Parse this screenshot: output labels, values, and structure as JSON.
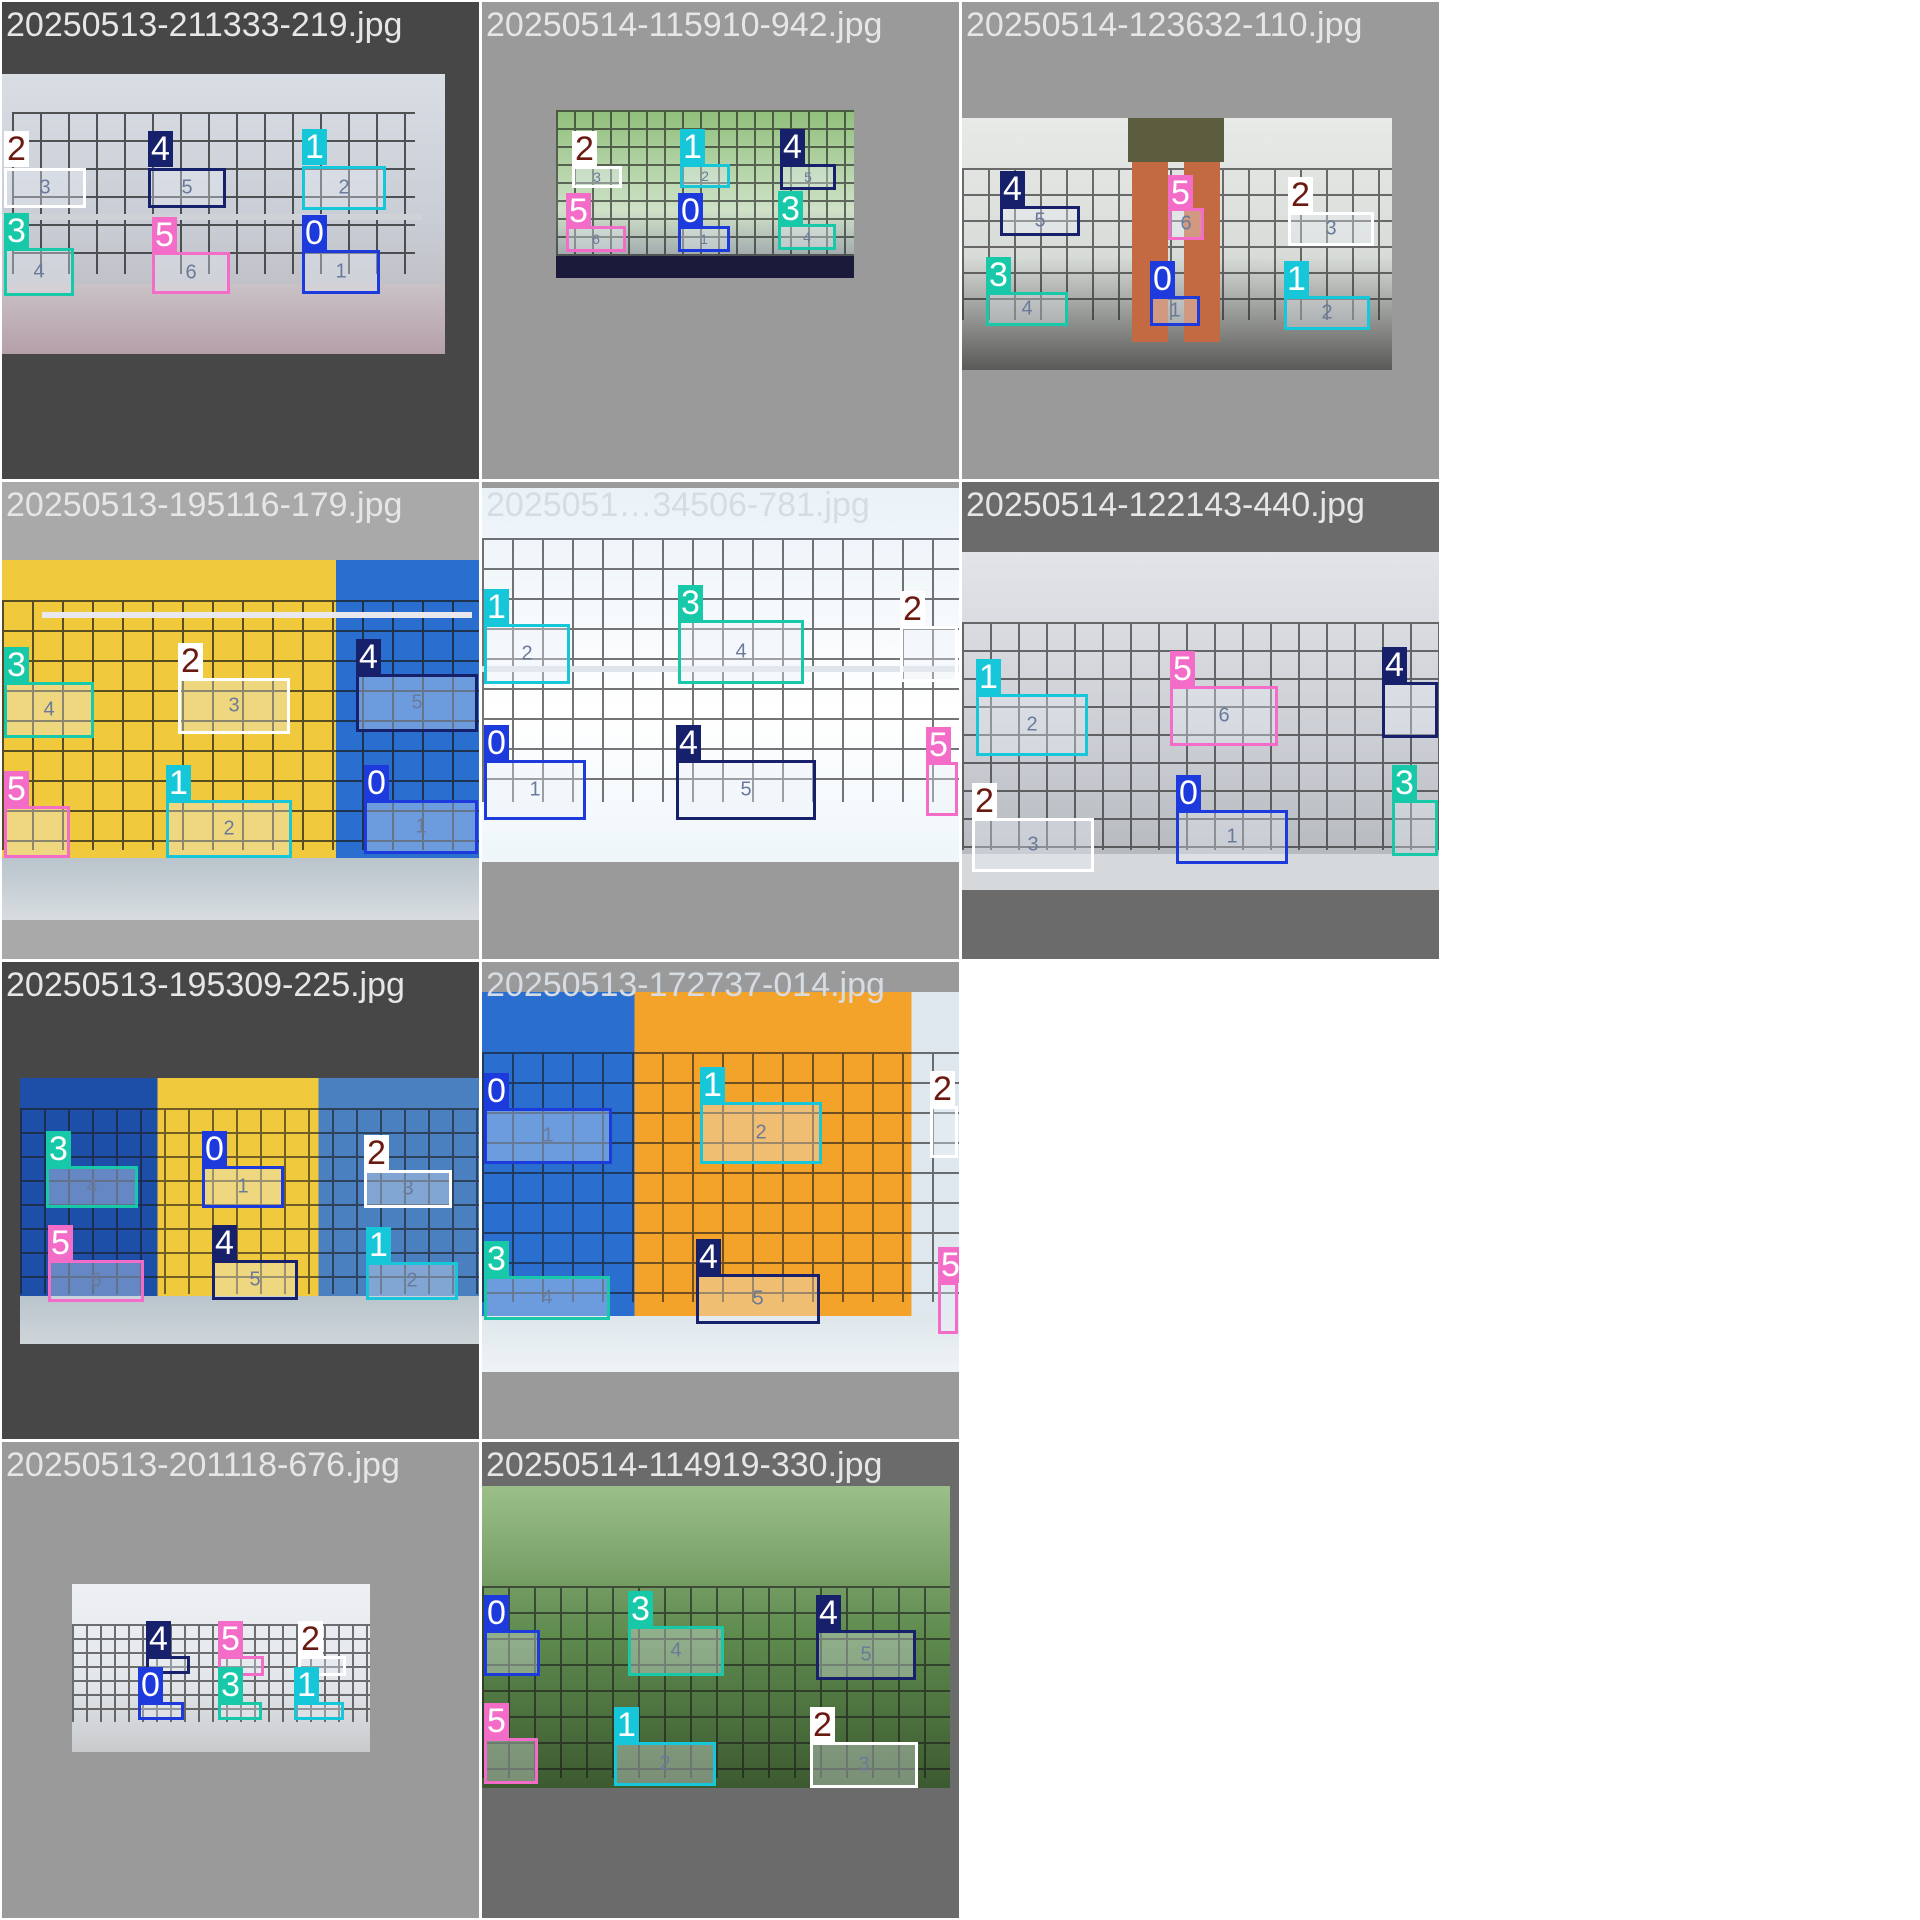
{
  "class_colors": {
    "0": "#1d3bdc",
    "1": "#16c7d9",
    "2": "#ffffff",
    "3": "#17c9a8",
    "4": "#17206b",
    "5": "#f36dc8"
  },
  "label_text_colors": {
    "0": "#ffffff",
    "1": "#ffffff",
    "2": "#6b1a12",
    "3": "#ffffff",
    "4": "#ffffff",
    "5": "#ffffff"
  },
  "tiles": [
    {
      "filename": "20250513-211333-219.jpg",
      "boxes": [
        {
          "cls": "2",
          "inner": "3"
        },
        {
          "cls": "4",
          "inner": "5"
        },
        {
          "cls": "1",
          "inner": "2"
        },
        {
          "cls": "3",
          "inner": "4"
        },
        {
          "cls": "5",
          "inner": "6"
        },
        {
          "cls": "0",
          "inner": "1"
        }
      ]
    },
    {
      "filename": "20250514-115910-942.jpg",
      "boxes": [
        {
          "cls": "2",
          "inner": "3"
        },
        {
          "cls": "1",
          "inner": "2"
        },
        {
          "cls": "4",
          "inner": "5"
        },
        {
          "cls": "5",
          "inner": "6"
        },
        {
          "cls": "0",
          "inner": "1"
        },
        {
          "cls": "3",
          "inner": "4"
        }
      ]
    },
    {
      "filename": "20250514-123632-110.jpg",
      "boxes": [
        {
          "cls": "4",
          "inner": "5"
        },
        {
          "cls": "5",
          "inner": "6"
        },
        {
          "cls": "2",
          "inner": "3"
        },
        {
          "cls": "3",
          "inner": "4"
        },
        {
          "cls": "0",
          "inner": "1"
        },
        {
          "cls": "1",
          "inner": "2"
        }
      ]
    },
    {
      "filename": "20250513-195116-179.jpg",
      "boxes": [
        {
          "cls": "3",
          "inner": "4"
        },
        {
          "cls": "2",
          "inner": "3"
        },
        {
          "cls": "4",
          "inner": "5"
        },
        {
          "cls": "5",
          "inner": ""
        },
        {
          "cls": "1",
          "inner": "2"
        },
        {
          "cls": "0",
          "inner": "1"
        }
      ]
    },
    {
      "filename": "2025051…34506-781.jpg",
      "boxes": [
        {
          "cls": "1",
          "inner": "2"
        },
        {
          "cls": "3",
          "inner": "4"
        },
        {
          "cls": "2",
          "inner": ""
        },
        {
          "cls": "0",
          "inner": "1"
        },
        {
          "cls": "4",
          "inner": "5"
        },
        {
          "cls": "5",
          "inner": ""
        }
      ]
    },
    {
      "filename": "20250514-122143-440.jpg",
      "boxes": [
        {
          "cls": "1",
          "inner": "2"
        },
        {
          "cls": "5",
          "inner": "6"
        },
        {
          "cls": "4",
          "inner": ""
        },
        {
          "cls": "2",
          "inner": "3"
        },
        {
          "cls": "0",
          "inner": "1"
        },
        {
          "cls": "3",
          "inner": ""
        }
      ]
    },
    {
      "filename": "20250513-195309-225.jpg",
      "boxes": [
        {
          "cls": "3",
          "inner": "4"
        },
        {
          "cls": "0",
          "inner": "1"
        },
        {
          "cls": "2",
          "inner": "3"
        },
        {
          "cls": "5",
          "inner": "6"
        },
        {
          "cls": "4",
          "inner": "5"
        },
        {
          "cls": "1",
          "inner": "2"
        }
      ]
    },
    {
      "filename": "20250513-172737-014.jpg",
      "boxes": [
        {
          "cls": "0",
          "inner": "1"
        },
        {
          "cls": "1",
          "inner": "2"
        },
        {
          "cls": "2",
          "inner": ""
        },
        {
          "cls": "3",
          "inner": "4"
        },
        {
          "cls": "4",
          "inner": "5"
        },
        {
          "cls": "5",
          "inner": ""
        }
      ]
    },
    {
      "filename": "20250513-201118-676.jpg",
      "boxes": [
        {
          "cls": "4",
          "inner": ""
        },
        {
          "cls": "5",
          "inner": ""
        },
        {
          "cls": "2",
          "inner": ""
        },
        {
          "cls": "0",
          "inner": ""
        },
        {
          "cls": "3",
          "inner": ""
        },
        {
          "cls": "1",
          "inner": ""
        }
      ]
    },
    {
      "filename": "20250514-114919-330.jpg",
      "boxes": [
        {
          "cls": "0",
          "inner": ""
        },
        {
          "cls": "3",
          "inner": "4"
        },
        {
          "cls": "4",
          "inner": "5"
        },
        {
          "cls": "5",
          "inner": ""
        },
        {
          "cls": "1",
          "inner": "2"
        },
        {
          "cls": "2",
          "inner": "3"
        }
      ]
    }
  ]
}
